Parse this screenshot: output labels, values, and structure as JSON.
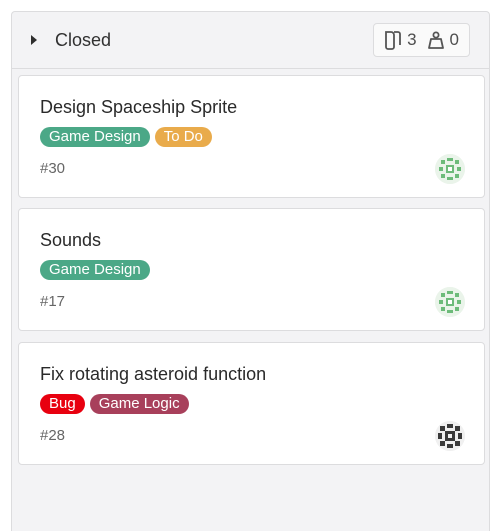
{
  "column": {
    "title": "Closed",
    "issue_count": "3",
    "weight_count": "0",
    "icons": {
      "toggle": "chevron-right-icon",
      "issues": "issues-icon",
      "weight": "weight-icon"
    }
  },
  "colors": {
    "game_design": "#4ba887",
    "to_do": "#e9ab4b",
    "bug": "#e8000f",
    "game_logic": "#a8405b"
  },
  "cards": [
    {
      "title": "Design Spaceship Sprite",
      "number": "#30",
      "labels": [
        {
          "text": "Game Design",
          "color": "#4ba887"
        },
        {
          "text": "To Do",
          "color": "#e9ab4b"
        }
      ],
      "avatar": "green-identicon"
    },
    {
      "title": "Sounds",
      "number": "#17",
      "labels": [
        {
          "text": "Game Design",
          "color": "#4ba887"
        }
      ],
      "avatar": "green-identicon"
    },
    {
      "title": "Fix rotating asteroid function",
      "number": "#28",
      "labels": [
        {
          "text": "Bug",
          "color": "#e8000f"
        },
        {
          "text": "Game Logic",
          "color": "#a8405b"
        }
      ],
      "avatar": "dark-identicon"
    }
  ]
}
